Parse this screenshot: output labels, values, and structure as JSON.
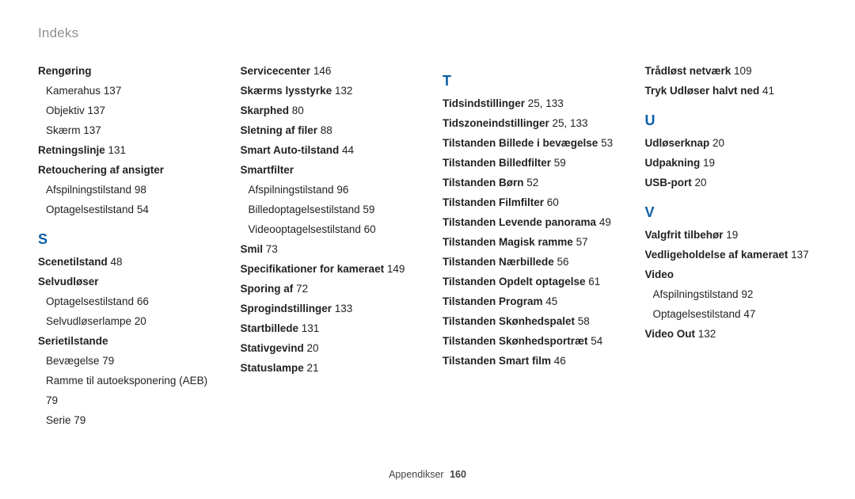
{
  "header": {
    "title": "Indeks"
  },
  "footer": {
    "label": "Appendikser",
    "page": "160"
  },
  "col1": [
    {
      "type": "head",
      "text": "Rengøring"
    },
    {
      "type": "sub",
      "text": "Kamerahus",
      "pg": "137"
    },
    {
      "type": "sub",
      "text": "Objektiv",
      "pg": "137"
    },
    {
      "type": "sub",
      "text": "Skærm",
      "pg": "137"
    },
    {
      "type": "entry",
      "text": "Retningslinje",
      "pg": "131"
    },
    {
      "type": "head",
      "text": "Retouchering af ansigter"
    },
    {
      "type": "sub",
      "text": "Afspilningstilstand",
      "pg": "98"
    },
    {
      "type": "sub",
      "text": "Optagelsestilstand",
      "pg": "54"
    },
    {
      "type": "letter",
      "text": "S"
    },
    {
      "type": "entry",
      "text": "Scenetilstand",
      "pg": "48"
    },
    {
      "type": "head",
      "text": "Selvudløser"
    },
    {
      "type": "sub",
      "text": "Optagelsestilstand",
      "pg": "66"
    },
    {
      "type": "sub",
      "text": "Selvudløserlampe",
      "pg": "20"
    },
    {
      "type": "head",
      "text": "Serietilstande"
    },
    {
      "type": "sub",
      "text": "Bevægelse",
      "pg": "79"
    },
    {
      "type": "sub",
      "text": "Ramme til autoeksponering (AEB)",
      "pg": "79"
    },
    {
      "type": "sub",
      "text": "Serie",
      "pg": "79"
    }
  ],
  "col2": [
    {
      "type": "entry",
      "text": "Servicecenter",
      "pg": "146"
    },
    {
      "type": "entry",
      "text": "Skærms lysstyrke",
      "pg": "132"
    },
    {
      "type": "entry",
      "text": "Skarphed",
      "pg": "80"
    },
    {
      "type": "entry",
      "text": "Sletning af filer",
      "pg": "88"
    },
    {
      "type": "entry",
      "text": "Smart Auto-tilstand",
      "pg": "44"
    },
    {
      "type": "head",
      "text": "Smartfilter"
    },
    {
      "type": "sub",
      "text": "Afspilningstilstand",
      "pg": "96"
    },
    {
      "type": "sub",
      "text": "Billedoptagelsestilstand",
      "pg": "59"
    },
    {
      "type": "sub",
      "text": "Videooptagelsestilstand",
      "pg": "60"
    },
    {
      "type": "entry",
      "text": "Smil",
      "pg": "73"
    },
    {
      "type": "entry",
      "text": "Specifikationer for kameraet",
      "pg": "149"
    },
    {
      "type": "entry",
      "text": "Sporing af",
      "pg": "72"
    },
    {
      "type": "entry",
      "text": "Sprogindstillinger",
      "pg": "133"
    },
    {
      "type": "entry",
      "text": "Startbillede",
      "pg": "131"
    },
    {
      "type": "entry",
      "text": "Stativgevind",
      "pg": "20"
    },
    {
      "type": "entry",
      "text": "Statuslampe",
      "pg": "21"
    }
  ],
  "col3": [
    {
      "type": "letter",
      "text": "T"
    },
    {
      "type": "entry",
      "text": "Tidsindstillinger",
      "pg": "25, 133"
    },
    {
      "type": "entry",
      "text": "Tidszoneindstillinger",
      "pg": "25, 133"
    },
    {
      "type": "entry",
      "text": "Tilstanden Billede i bevægelse",
      "pg": "53"
    },
    {
      "type": "entry",
      "text": "Tilstanden Billedfilter",
      "pg": "59"
    },
    {
      "type": "entry",
      "text": "Tilstanden Børn",
      "pg": "52"
    },
    {
      "type": "entry",
      "text": "Tilstanden Filmfilter",
      "pg": "60"
    },
    {
      "type": "entry",
      "text": "Tilstanden Levende panorama",
      "pg": "49"
    },
    {
      "type": "entry",
      "text": "Tilstanden Magisk ramme",
      "pg": "57"
    },
    {
      "type": "entry",
      "text": "Tilstanden Nærbillede",
      "pg": "56"
    },
    {
      "type": "entry",
      "text": "Tilstanden Opdelt optagelse",
      "pg": "61"
    },
    {
      "type": "entry",
      "text": "Tilstanden Program",
      "pg": "45"
    },
    {
      "type": "entry",
      "text": "Tilstanden Skønhedspalet",
      "pg": "58"
    },
    {
      "type": "entry",
      "text": "Tilstanden Skønhedsportræt",
      "pg": "54"
    },
    {
      "type": "entry",
      "text": "Tilstanden Smart film",
      "pg": "46"
    }
  ],
  "col4": [
    {
      "type": "entry",
      "text": "Trådløst netværk",
      "pg": "109"
    },
    {
      "type": "entry",
      "text": "Tryk Udløser halvt ned",
      "pg": "41"
    },
    {
      "type": "letter",
      "text": "U"
    },
    {
      "type": "entry",
      "text": "Udløserknap",
      "pg": "20"
    },
    {
      "type": "entry",
      "text": "Udpakning",
      "pg": "19"
    },
    {
      "type": "entry",
      "text": "USB-port",
      "pg": "20"
    },
    {
      "type": "letter",
      "text": "V"
    },
    {
      "type": "entry",
      "text": "Valgfrit tilbehør",
      "pg": "19"
    },
    {
      "type": "entry",
      "text": "Vedligeholdelse af kameraet",
      "pg": "137"
    },
    {
      "type": "head",
      "text": "Video"
    },
    {
      "type": "sub",
      "text": "Afspilningstilstand",
      "pg": "92"
    },
    {
      "type": "sub",
      "text": "Optagelsestilstand",
      "pg": "47"
    },
    {
      "type": "entry",
      "text": "Video Out",
      "pg": "132"
    }
  ]
}
